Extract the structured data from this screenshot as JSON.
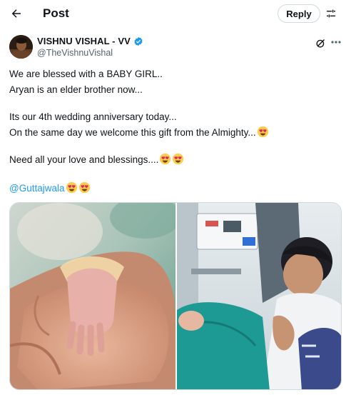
{
  "header": {
    "title": "Post",
    "reply_label": "Reply"
  },
  "author": {
    "display_name": "VISHNU VISHAL - VV",
    "handle": "@TheVishnuVishal"
  },
  "tweet": {
    "line1": "We are blessed with a BABY GIRL..",
    "line2": "Aryan is an elder brother now...",
    "line3": "Its our 4th wedding anniversary today...",
    "line4": "On the same day we welcome this gift from the Almighty...",
    "line5": "Need all your love and blessings....",
    "mention": "@Guttajwala"
  },
  "icons": {
    "back": "back-arrow-icon",
    "settings": "sliders-icon",
    "verified": "verified-badge-icon",
    "grok": "grok-icon",
    "more": "more-icon",
    "emoji": "heart-eyes-emoji"
  },
  "colors": {
    "accent": "#1d9bf0",
    "text": "#0f1419",
    "secondary": "#536471"
  }
}
